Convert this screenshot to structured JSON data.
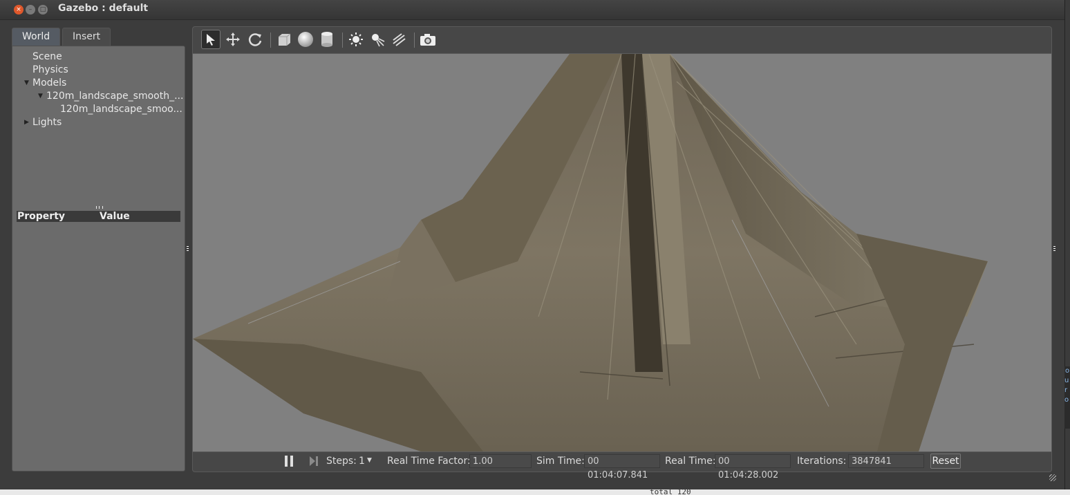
{
  "window": {
    "title": "Gazebo : default",
    "buttons": {
      "close": "×",
      "minimize": "–",
      "maximize": "□"
    }
  },
  "left_panel": {
    "tabs": [
      "World",
      "Insert"
    ],
    "active_tab": "World",
    "tree": [
      {
        "label": "Scene",
        "indent": 0,
        "expander": ""
      },
      {
        "label": "Physics",
        "indent": 0,
        "expander": ""
      },
      {
        "label": "Models",
        "indent": 0,
        "expander": "expanded"
      },
      {
        "label": "120m_landscape_smooth_...",
        "indent": 1,
        "expander": "expanded"
      },
      {
        "label": "120m_landscape_smoo...",
        "indent": 2,
        "expander": ""
      },
      {
        "label": "Lights",
        "indent": 0,
        "expander": "collapsed"
      }
    ],
    "property_header": {
      "property": "Property",
      "value": "Value"
    }
  },
  "toolbar": {
    "tools": [
      {
        "icon": "select-arrow-icon",
        "active": true
      },
      {
        "icon": "translate-icon",
        "active": false
      },
      {
        "icon": "rotate-icon",
        "active": false
      },
      {
        "icon": "box-shape-icon",
        "active": false
      },
      {
        "icon": "sphere-shape-icon",
        "active": false
      },
      {
        "icon": "cylinder-shape-icon",
        "active": false
      },
      {
        "icon": "point-light-icon",
        "active": false
      },
      {
        "icon": "spot-light-icon",
        "active": false
      },
      {
        "icon": "directional-light-icon",
        "active": false
      },
      {
        "icon": "screenshot-camera-icon",
        "active": false
      }
    ]
  },
  "viewport": {
    "background": "#808080",
    "terrain_color": "#7a6f5e"
  },
  "bottom_bar": {
    "steps_label": "Steps:",
    "steps_value": "1",
    "rtf_label": "Real Time Factor:",
    "rtf_value": "1.00",
    "sim_time_label": "Sim Time:",
    "sim_time_value": "00 01:04:07.841",
    "real_time_label": "Real Time:",
    "real_time_value": "00 01:04:28.002",
    "iterations_label": "Iterations:",
    "iterations_value": "3847841",
    "reset_label": "Reset"
  },
  "background_terminal": {
    "bottom_text": "total 120",
    "side_text": "o\nu\nr\no"
  }
}
